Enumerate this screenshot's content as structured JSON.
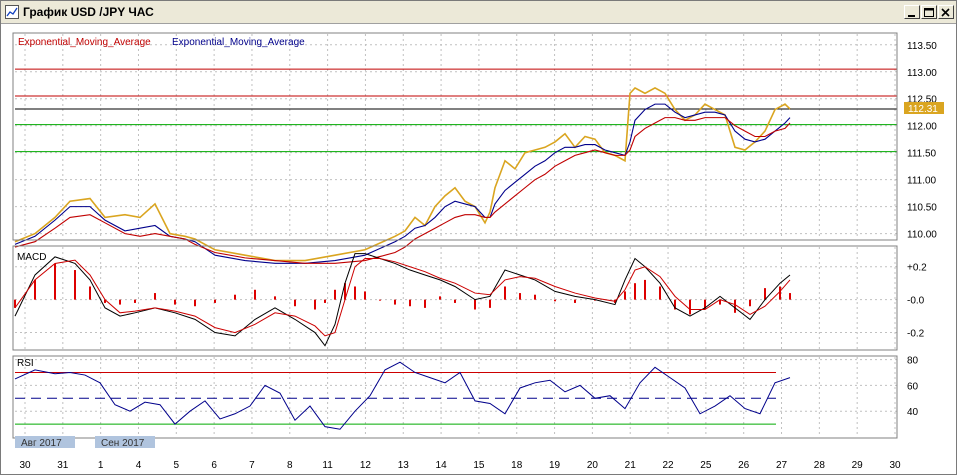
{
  "window": {
    "title": "График USD /JPY  ЧАС"
  },
  "colors": {
    "price": "#daa520",
    "ema_fast": "#00008b",
    "ema_slow": "#c00000",
    "macd_hist": "#dd0000",
    "rsi": "#00008b",
    "rsi_overbought": "#cc00cc",
    "rsi_oversold": "#00aa00",
    "grid": "#c0c0c0"
  },
  "chart_data": [
    {
      "type": "line",
      "panel": "price",
      "indicator_labels": [
        "Exponential_Moving_Average",
        "Exponential_Moving_Average"
      ],
      "y_ticks": [
        "113.50",
        "113.00",
        "112.50",
        "112.00",
        "111.50",
        "111.00",
        "110.50",
        "110.00"
      ],
      "ylim": [
        109.9,
        113.7
      ],
      "current_price_label": "112.31",
      "horizontal_levels": [
        {
          "value": 113.05,
          "color": "#c00000"
        },
        {
          "value": 112.55,
          "color": "#c00000"
        },
        {
          "value": 112.31,
          "color": "#000000"
        },
        {
          "value": 112.02,
          "color": "#00aa00"
        },
        {
          "value": 111.52,
          "color": "#00aa00"
        }
      ],
      "x": [
        0,
        20,
        40,
        55,
        75,
        90,
        110,
        125,
        140,
        155,
        170,
        180,
        200,
        230,
        260,
        290,
        320,
        350,
        380,
        390,
        400,
        410,
        420,
        430,
        440,
        450,
        460,
        470,
        475,
        480,
        490,
        500,
        510,
        520,
        530,
        540,
        550,
        560,
        570,
        580,
        590,
        600,
        610,
        615,
        620,
        630,
        640,
        650,
        660,
        670,
        680,
        690,
        700,
        710,
        720,
        730,
        740,
        750,
        760,
        770,
        775
      ],
      "series": [
        {
          "name": "Exponential_Moving_Average",
          "color": "#daa520",
          "values": [
            109.85,
            110.0,
            110.3,
            110.6,
            110.65,
            110.3,
            110.35,
            110.3,
            110.55,
            110.0,
            109.95,
            109.9,
            109.7,
            109.6,
            109.5,
            109.5,
            109.6,
            109.7,
            109.95,
            110.05,
            110.3,
            110.15,
            110.5,
            110.7,
            110.85,
            110.6,
            110.5,
            110.2,
            110.4,
            110.85,
            111.35,
            111.2,
            111.5,
            111.55,
            111.6,
            111.7,
            111.85,
            111.6,
            111.8,
            111.75,
            111.5,
            111.45,
            111.35,
            112.6,
            112.7,
            112.6,
            112.7,
            112.6,
            112.3,
            112.1,
            112.2,
            112.4,
            112.3,
            112.2,
            111.6,
            111.55,
            111.7,
            111.9,
            112.3,
            112.4,
            112.31
          ]
        },
        {
          "name": "Exponential_Moving_Average",
          "color": "#00008b",
          "values": [
            109.8,
            109.95,
            110.25,
            110.5,
            110.5,
            110.25,
            110.05,
            110.1,
            110.15,
            109.95,
            109.9,
            109.85,
            109.6,
            109.5,
            109.45,
            109.45,
            109.5,
            109.6,
            109.85,
            109.95,
            110.1,
            110.15,
            110.3,
            110.5,
            110.6,
            110.55,
            110.5,
            110.3,
            110.3,
            110.55,
            110.8,
            110.95,
            111.1,
            111.25,
            111.35,
            111.5,
            111.6,
            111.6,
            111.65,
            111.65,
            111.55,
            111.5,
            111.45,
            111.7,
            112.1,
            112.3,
            112.4,
            112.4,
            112.25,
            112.15,
            112.2,
            112.25,
            112.25,
            112.2,
            111.9,
            111.75,
            111.7,
            111.75,
            111.9,
            112.05,
            112.15
          ]
        },
        {
          "name": "Exponential_Moving_Average",
          "color": "#c00000",
          "values": [
            109.75,
            109.85,
            110.1,
            110.3,
            110.35,
            110.2,
            110.0,
            109.95,
            110.0,
            109.95,
            109.9,
            109.8,
            109.65,
            109.55,
            109.5,
            109.45,
            109.45,
            109.5,
            109.65,
            109.75,
            109.9,
            110.0,
            110.1,
            110.2,
            110.3,
            110.35,
            110.35,
            110.3,
            110.3,
            110.4,
            110.55,
            110.7,
            110.85,
            111.0,
            111.1,
            111.25,
            111.35,
            111.45,
            111.5,
            111.55,
            111.5,
            111.45,
            111.45,
            111.55,
            111.8,
            111.95,
            112.05,
            112.15,
            112.15,
            112.1,
            112.1,
            112.15,
            112.15,
            112.15,
            112.0,
            111.9,
            111.8,
            111.8,
            111.9,
            111.95,
            112.05
          ]
        }
      ]
    },
    {
      "type": "bar",
      "panel": "macd",
      "label": "MACD",
      "y_ticks": [
        "+0.2",
        "-0.0",
        "-0.2"
      ],
      "ylim": [
        -0.3,
        0.32
      ],
      "x": [
        0,
        20,
        40,
        60,
        75,
        90,
        105,
        120,
        140,
        160,
        180,
        200,
        220,
        240,
        260,
        280,
        300,
        310,
        320,
        330,
        340,
        350,
        365,
        380,
        395,
        410,
        425,
        440,
        460,
        475,
        490,
        505,
        520,
        540,
        560,
        580,
        600,
        610,
        620,
        630,
        645,
        660,
        675,
        690,
        705,
        720,
        735,
        750,
        765,
        775
      ],
      "series": [
        {
          "name": "MACD",
          "color": "#dd0000",
          "values": [
            -0.05,
            0.12,
            0.22,
            0.18,
            0.08,
            -0.02,
            -0.03,
            -0.02,
            0.04,
            -0.03,
            -0.04,
            -0.02,
            0.03,
            0.06,
            0.02,
            -0.04,
            -0.06,
            -0.02,
            0.06,
            0.1,
            0.08,
            0.05,
            0.0,
            -0.03,
            -0.04,
            -0.05,
            0.02,
            -0.02,
            -0.06,
            -0.05,
            0.08,
            0.04,
            0.03,
            -0.01,
            -0.02,
            0.0,
            -0.02,
            0.05,
            0.1,
            0.12,
            0.08,
            -0.06,
            -0.09,
            -0.06,
            -0.03,
            -0.08,
            -0.04,
            0.07,
            0.08,
            0.04
          ]
        },
        {
          "name": "MACD",
          "color": "#000000",
          "values": [
            -0.1,
            0.15,
            0.26,
            0.22,
            0.12,
            -0.05,
            -0.1,
            -0.08,
            -0.05,
            -0.08,
            -0.12,
            -0.2,
            -0.22,
            -0.12,
            -0.05,
            -0.12,
            -0.2,
            -0.28,
            -0.15,
            0.1,
            0.28,
            0.28,
            0.25,
            0.22,
            0.18,
            0.15,
            0.12,
            0.08,
            0.0,
            0.02,
            0.18,
            0.15,
            0.12,
            0.05,
            0.02,
            0.0,
            -0.03,
            0.12,
            0.25,
            0.2,
            0.1,
            -0.05,
            -0.1,
            -0.05,
            0.02,
            -0.05,
            -0.12,
            0.0,
            0.1,
            0.15
          ]
        },
        {
          "name": "MACD",
          "color": "#cc0000",
          "values": [
            -0.05,
            0.12,
            0.22,
            0.24,
            0.15,
            0.0,
            -0.08,
            -0.07,
            -0.05,
            -0.07,
            -0.1,
            -0.17,
            -0.2,
            -0.15,
            -0.08,
            -0.1,
            -0.16,
            -0.22,
            -0.2,
            0.0,
            0.2,
            0.25,
            0.25,
            0.23,
            0.2,
            0.17,
            0.13,
            0.1,
            0.04,
            0.03,
            0.12,
            0.14,
            0.13,
            0.08,
            0.04,
            0.01,
            -0.01,
            0.06,
            0.18,
            0.2,
            0.14,
            0.02,
            -0.06,
            -0.06,
            0.0,
            -0.03,
            -0.09,
            -0.04,
            0.05,
            0.12
          ]
        }
      ]
    },
    {
      "type": "line",
      "panel": "rsi",
      "label": "RSI",
      "y_ticks": [
        "80",
        "60",
        "40"
      ],
      "ylim": [
        20,
        82
      ],
      "levels": [
        70,
        50,
        30
      ],
      "x": [
        0,
        20,
        40,
        55,
        70,
        85,
        100,
        115,
        130,
        145,
        160,
        175,
        190,
        205,
        220,
        235,
        250,
        265,
        280,
        295,
        310,
        325,
        340,
        355,
        370,
        385,
        400,
        415,
        430,
        445,
        460,
        475,
        490,
        505,
        520,
        535,
        550,
        565,
        580,
        595,
        610,
        625,
        640,
        655,
        670,
        685,
        700,
        715,
        730,
        745,
        760,
        775
      ],
      "series": [
        {
          "name": "RSI",
          "color": "#00008b",
          "values": [
            65,
            72,
            69,
            70,
            68,
            62,
            45,
            40,
            47,
            45,
            30,
            40,
            48,
            34,
            38,
            44,
            60,
            54,
            33,
            44,
            28,
            26,
            40,
            52,
            72,
            78,
            70,
            66,
            62,
            70,
            48,
            46,
            38,
            58,
            62,
            64,
            55,
            60,
            50,
            52,
            42,
            62,
            74,
            66,
            58,
            38,
            44,
            52,
            42,
            38,
            62,
            66
          ]
        }
      ]
    }
  ],
  "x_axis": {
    "date_labels": [
      "30",
      "31",
      "1",
      "4",
      "5",
      "6",
      "7",
      "8",
      "11",
      "12",
      "13",
      "14",
      "15",
      "18",
      "19",
      "20",
      "21",
      "22",
      "25",
      "26",
      "27",
      "28",
      "29",
      "30"
    ],
    "month_labels": [
      "Авг 2017",
      "Сен 2017"
    ]
  }
}
